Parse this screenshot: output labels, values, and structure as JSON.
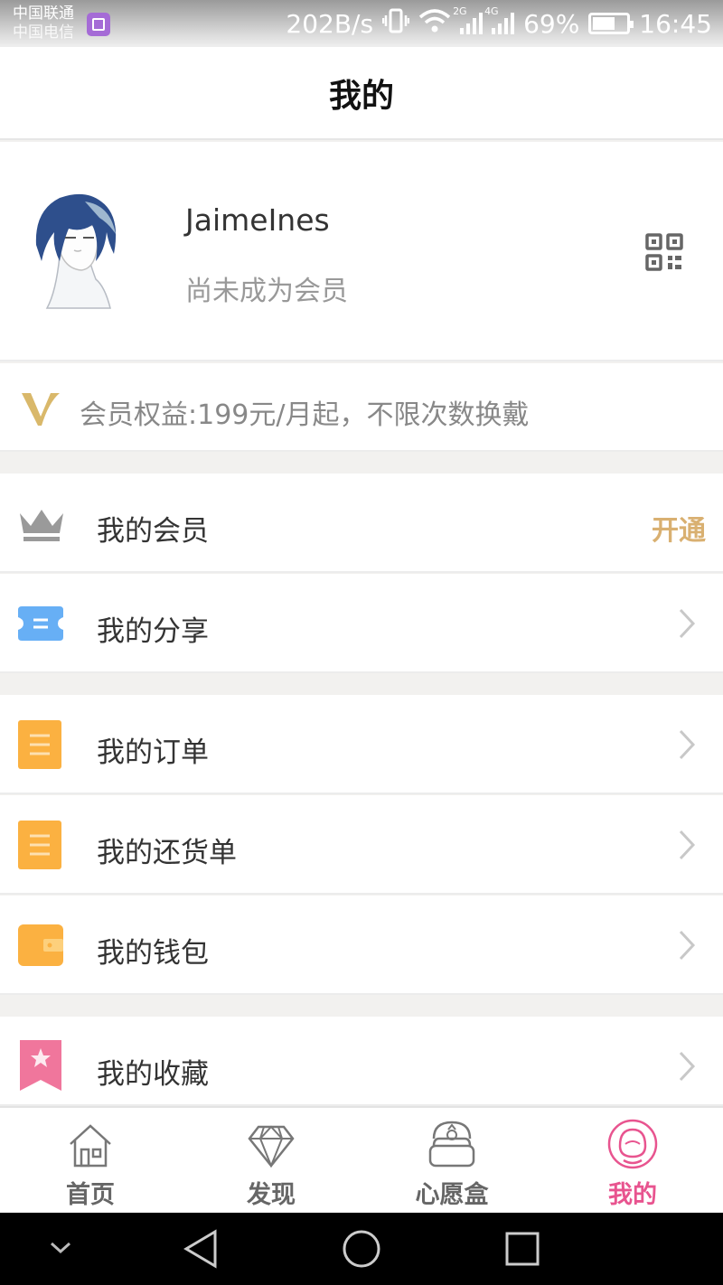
{
  "status_bar": {
    "carrier_1": "中国联通",
    "carrier_2": "中国电信",
    "net_speed": "202B/s",
    "net_2g": "2G",
    "net_4g": "4G",
    "net_2g_b": "2G",
    "battery": "69%",
    "time": "16:45"
  },
  "header": {
    "title": "我的"
  },
  "profile": {
    "username": "JaimeInes",
    "member_status": "尚未成为会员"
  },
  "benefits": {
    "text": "会员权益:199元/月起，不限次数换戴"
  },
  "menu": {
    "membership": {
      "label": "我的会员",
      "action": "开通"
    },
    "share": {
      "label": "我的分享"
    },
    "orders": {
      "label": "我的订单"
    },
    "returns": {
      "label": "我的还货单"
    },
    "wallet": {
      "label": "我的钱包"
    },
    "favorites": {
      "label": "我的收藏"
    }
  },
  "tabs": {
    "home": "首页",
    "discover": "发现",
    "wishbox": "心愿盒",
    "mine": "我的"
  },
  "colors": {
    "accent_pink": "#e8548f",
    "gold": "#d9b071",
    "orange": "#fbb141",
    "blue": "#67aff5",
    "bookmark": "#f0769c"
  }
}
